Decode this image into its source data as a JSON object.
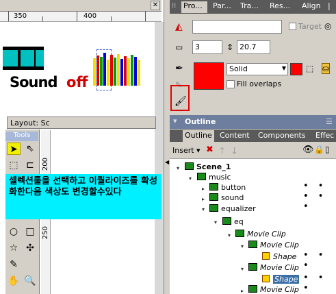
{
  "ruler": {
    "labels": [
      "350",
      "400"
    ]
  },
  "stage": {
    "sound": "Sound",
    "off": "off"
  },
  "layout": {
    "title": "Layout: Sc"
  },
  "tools": {
    "label": "Tools"
  },
  "vruler": {
    "label1": "200",
    "label2": "250"
  },
  "note": {
    "text": "셀렉션툴을 선택하고 이퀄라이즈를 확성화한다음 색상도 변경할수있다"
  },
  "props": {
    "tabs": [
      "Pro...",
      "Par...",
      "Tra...",
      "Res...",
      "Align",
      "|"
    ],
    "target_label": "Target",
    "width_value": "3",
    "height_value": "20.7",
    "fill_style": "Solid",
    "fill_overlaps": "Fill overlaps",
    "fill_color": "#ff0000"
  },
  "outline": {
    "header": "Outline",
    "tabs": [
      "Outline",
      "Content",
      "Components",
      "Effec"
    ],
    "insert": "Insert",
    "tree": [
      {
        "label": "Scene_1"
      },
      {
        "label": "music"
      },
      {
        "label": "button"
      },
      {
        "label": "sound"
      },
      {
        "label": "equalizer"
      },
      {
        "label": "eq"
      },
      {
        "label": "Movie Clip"
      },
      {
        "label": "Movie Clip"
      },
      {
        "label": "Shape"
      },
      {
        "label": "Movie Clip"
      },
      {
        "label": "Shape"
      },
      {
        "label": "Movie Clip"
      }
    ]
  }
}
